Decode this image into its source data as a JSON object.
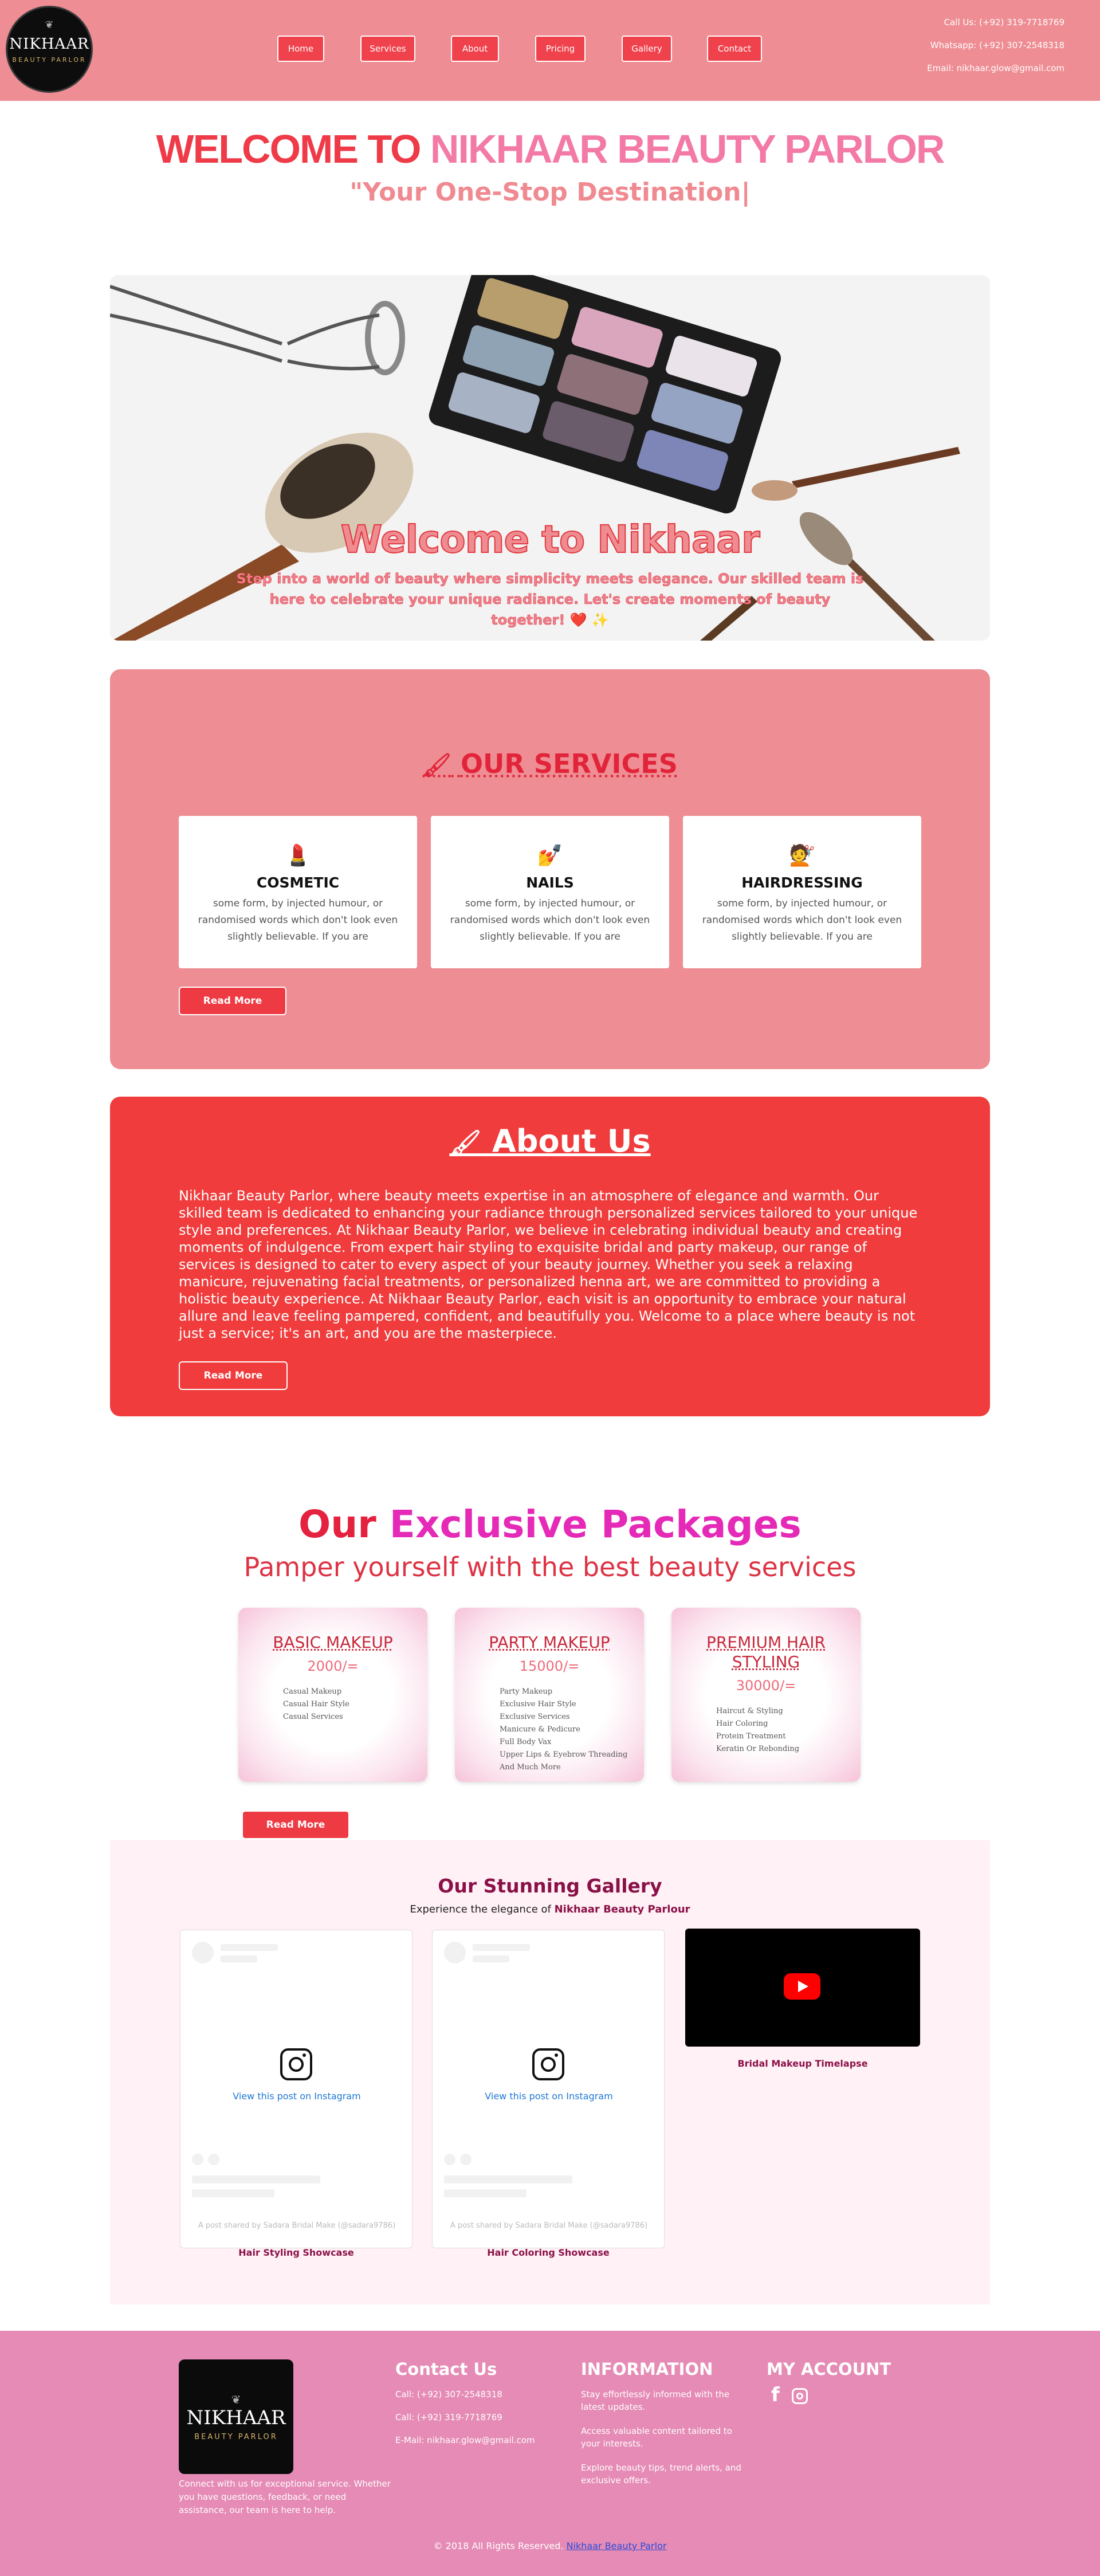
{
  "header": {
    "logo_name": "NIKHAAR",
    "logo_sub": "BEAUTY PARLOR",
    "nav": [
      "Home",
      "Services",
      "About",
      "Pricing",
      "Gallery",
      "Contact"
    ],
    "call": "Call Us: (+92) 319-7718769",
    "whatsapp": "Whatsapp: (+92) 307-2548318",
    "email": "Email: nikhaar.glow@gmail.com"
  },
  "welcome": {
    "part1": "WELCOME TO",
    "part2": "NIKHAAR BEAUTY PARLOR",
    "tagline": "\"Your One-Stop Destination|"
  },
  "hero": {
    "title": "Welcome to Nikhaar",
    "text": "Step into a world of beauty where simplicity meets elegance. Our skilled team is here to celebrate your unique radiance. Let's create moments of beauty together! ❤️ ✨"
  },
  "services": {
    "title": "OUR SERVICES",
    "cards": [
      {
        "name": "COSMETIC",
        "icon": "cosmetics-icon",
        "desc": "some form, by injected humour, or randomised words which don't look even slightly believable. If you are"
      },
      {
        "name": "NAILS",
        "icon": "nail-polish-icon",
        "desc": "some form, by injected humour, or randomised words which don't look even slightly believable. If you are"
      },
      {
        "name": "HAIRDRESSING",
        "icon": "hairdresser-icon",
        "desc": "some form, by injected humour, or randomised words which don't look even slightly believable. If you are"
      }
    ],
    "button": "Read More"
  },
  "about": {
    "title": "About Us",
    "text": "Nikhaar Beauty Parlor, where beauty meets expertise in an atmosphere of elegance and warmth. Our skilled team is dedicated to enhancing your radiance through personalized services tailored to your unique style and preferences. At Nikhaar Beauty Parlor, we believe in celebrating individual beauty and creating moments of indulgence. From expert hair styling to exquisite bridal and party makeup, our range of services is designed to cater to every aspect of your beauty journey. Whether you seek a relaxing manicure, rejuvenating facial treatments, or personalized henna art, we are committed to providing a holistic beauty experience. At Nikhaar Beauty Parlor, each visit is an opportunity to embrace your natural allure and leave feeling pampered, confident, and beautifully you. Welcome to a place where beauty is not just a service; it's an art, and you are the masterpiece.",
    "button": "Read More"
  },
  "packages": {
    "title1": "Our",
    "title2": "Exclusive Packages",
    "subtitle": "Pamper yourself with the best beauty services",
    "cards": [
      {
        "name": "BASIC MAKEUP",
        "price": "2000/=",
        "items": [
          "Casual Makeup",
          "Casual Hair Style",
          "Casual Services"
        ]
      },
      {
        "name": "PARTY MAKEUP",
        "price": "15000/=",
        "items": [
          "Party Makeup",
          "Exclusive Hair Style",
          "Exclusive Services",
          "Manicure & Pedicure",
          "Full Body Vax",
          "Upper Lips & Eyebrow Threading",
          "And Much More"
        ]
      },
      {
        "name": "PREMIUM HAIR STYLING",
        "price": "30000/=",
        "items": [
          "Haircut & Styling",
          "Hair Coloring",
          "Protein Treatment",
          "Keratin Or Rebonding"
        ]
      }
    ],
    "button": "Read More"
  },
  "gallery": {
    "title": "Our Stunning Gallery",
    "sub_prefix": "Experience the elegance of",
    "sub_highlight": "Nikhaar Beauty Parlour",
    "view_post": "View this post on Instagram",
    "caption": "A post shared by Sadara Bridal Make (@sadara9786)",
    "labels": [
      "Hair Styling Showcase",
      "Hair Coloring Showcase",
      "Bridal Makeup Timelapse"
    ]
  },
  "footer": {
    "desc": "Connect with us for exceptional service. Whether you have questions, feedback, or need assistance, our team is here to help.",
    "contact_title": "Contact Us",
    "contact_lines": [
      "Call: (+92) 307-2548318",
      "Call: (+92) 319-7718769",
      "E-Mail: nikhaar.glow@gmail.com"
    ],
    "info_title": "INFORMATION",
    "info_lines": [
      "Stay effortlessly informed with the latest updates.",
      "Access valuable content tailored to your interests.",
      "Explore beauty tips, trend alerts, and exclusive offers."
    ],
    "account_title": "MY ACCOUNT",
    "copyright": "© 2018 All Rights Reserved.",
    "copyright_link": "Nikhaar Beauty Parlor"
  },
  "colors": {
    "header_bg": "#ee8d93",
    "accent": "#ef3a48",
    "pink": "#f37aa6",
    "about_bg": "#f03c3c",
    "footer_bg": "#e58bb5",
    "gallery_accent": "#8a1148"
  }
}
